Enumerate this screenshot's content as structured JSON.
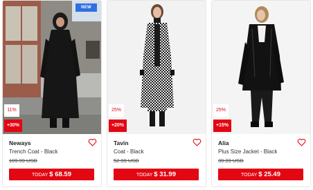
{
  "colors": {
    "accent_red": "#e30613",
    "new_badge_blue": "#2f6fe0"
  },
  "products": [
    {
      "badge_new": "NEW",
      "discount_percent": "11%",
      "discount_extra": "+30%",
      "brand": "Neways",
      "name": "Trench Coat - Black",
      "old_price": "109.99 USD",
      "today_label": "TODAY",
      "today_price": "$ 68.59",
      "favorite_icon": "heart-outline-icon"
    },
    {
      "discount_percent": "25%",
      "discount_extra": "+20%",
      "brand": "Tavin",
      "name": "Coat - Black",
      "old_price": "52.99 USD",
      "today_label": "TODAY",
      "today_price": "$ 31.99",
      "favorite_icon": "heart-outline-icon"
    },
    {
      "discount_percent": "25%",
      "discount_extra": "+15%",
      "brand": "Alia",
      "name": "Plus Size Jacket - Black",
      "old_price": "39.99 USD",
      "today_label": "TODAY",
      "today_price": "$ 25.49",
      "favorite_icon": "heart-outline-icon"
    }
  ]
}
